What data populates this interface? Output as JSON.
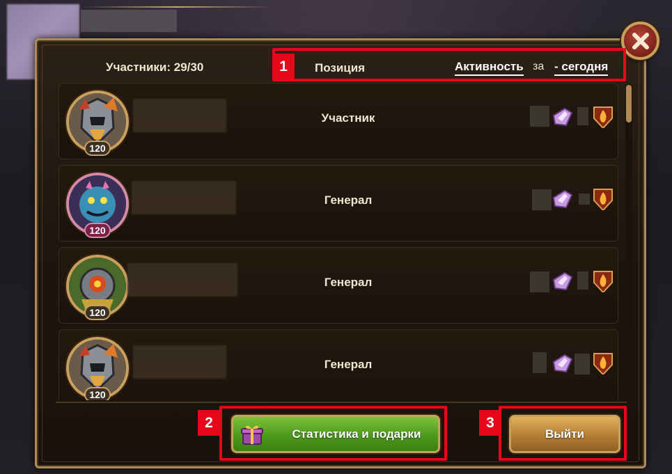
{
  "header": {
    "members_label": "Участники: 29/30",
    "position_label": "Позиция",
    "activity_label": "Активность",
    "activity_for": "за",
    "period_label": "- сегодня"
  },
  "members": [
    {
      "level": "120",
      "rank": "Участник",
      "hero_icon": "knight-hero-icon"
    },
    {
      "level": "120",
      "rank": "Генерал",
      "hero_icon": "monster-hero-icon"
    },
    {
      "level": "120",
      "rank": "Генерал",
      "hero_icon": "armored-hero-icon"
    },
    {
      "level": "120",
      "rank": "Генерал",
      "hero_icon": "knight-hero-icon"
    }
  ],
  "buttons": {
    "stats_gifts": "Статистика и подарки",
    "exit": "Выйти"
  },
  "badges": {
    "b1": "1",
    "b2": "2",
    "b3": "3"
  },
  "colors": {
    "highlight": "#e8061b",
    "gold_border": "#c9a15e",
    "green_button": "#4d9a1d",
    "exit_button": "#b98238"
  },
  "icons": [
    "close-icon",
    "gem-icon",
    "flame-shield-icon",
    "gift-icon"
  ]
}
